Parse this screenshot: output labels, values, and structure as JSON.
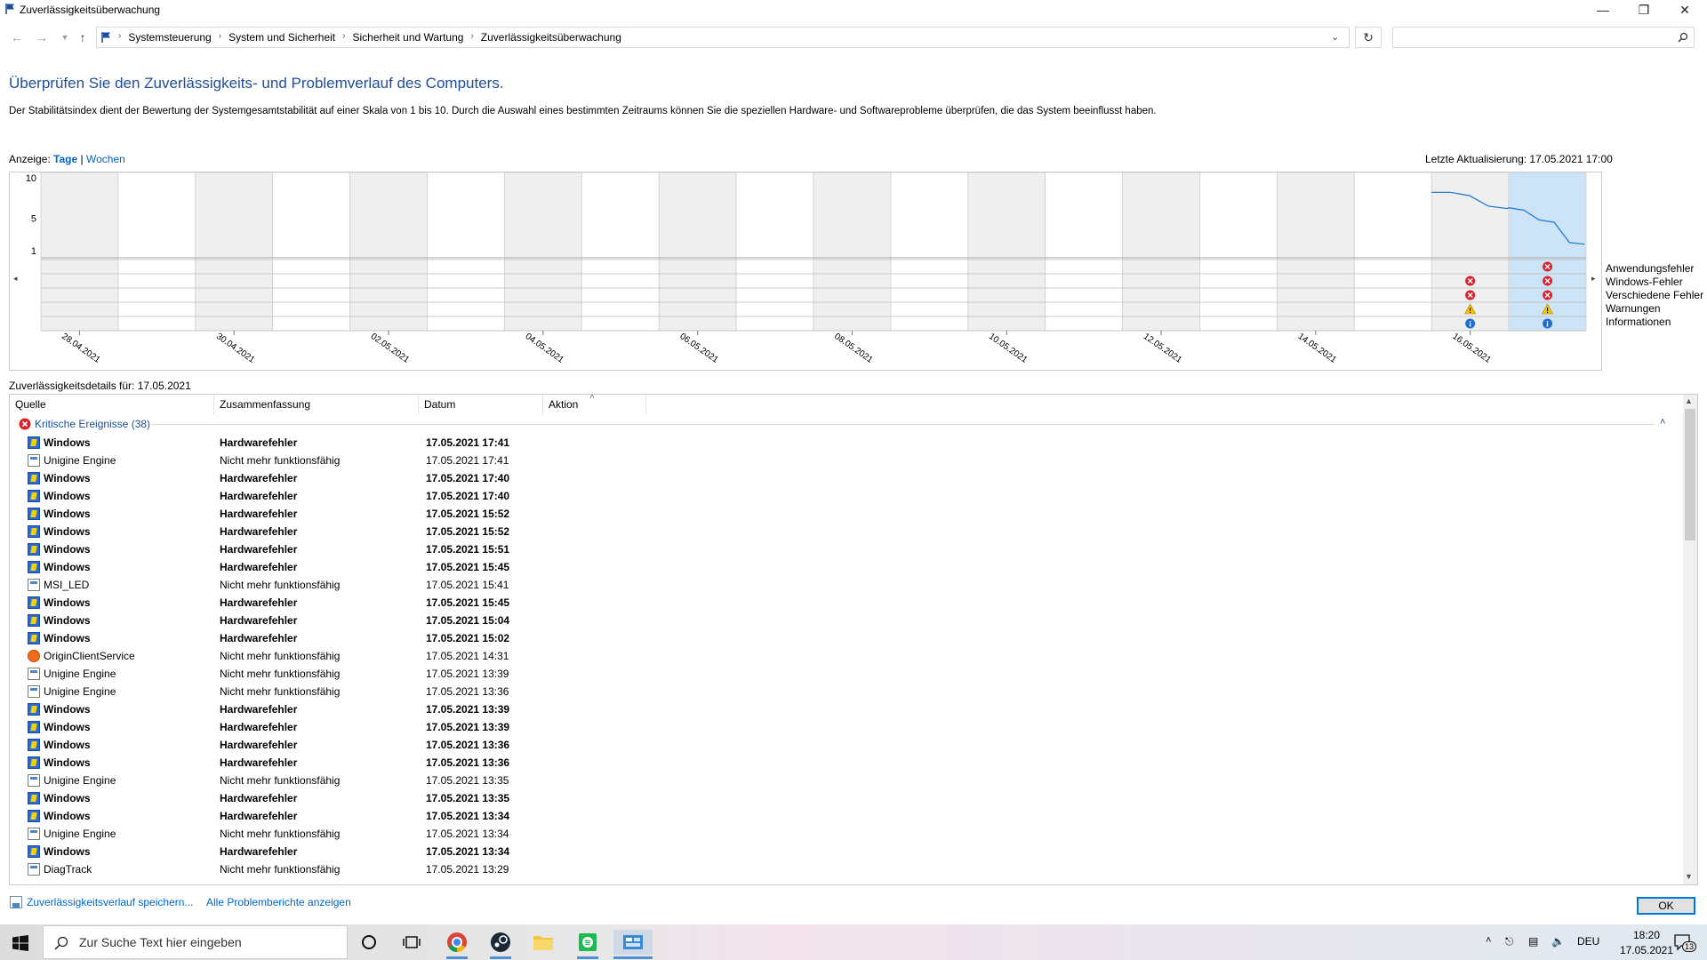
{
  "window": {
    "title": "Zuverlässigkeitsüberwachung"
  },
  "breadcrumb": [
    "Systemsteuerung",
    "System und Sicherheit",
    "Sicherheit und Wartung",
    "Zuverlässigkeitsüberwachung"
  ],
  "heading": "Überprüfen Sie den Zuverlässigkeits- und Problemverlauf des Computers.",
  "description": "Der Stabilitätsindex dient der Bewertung der Systemgesamtstabilität auf einer Skala von 1 bis 10. Durch die Auswahl eines bestimmten Zeitraums können Sie die speziellen Hardware- und Softwareprobleme überprüfen, die das System beeinflusst haben.",
  "view": {
    "label": "Anzeige:",
    "days": "Tage",
    "sep": "|",
    "weeks": "Wochen"
  },
  "last_update": "Letzte Aktualisierung: 17.05.2021 17:00",
  "chart_data": {
    "type": "line",
    "y_ticks": [
      "10",
      "5",
      "1"
    ],
    "ylim": [
      1,
      10
    ],
    "date_labels": [
      "28.04.2021",
      "30.04.2021",
      "02.05.2021",
      "04.05.2021",
      "06.05.2021",
      "08.05.2021",
      "10.05.2021",
      "12.05.2021",
      "14.05.2021",
      "16.05.2021"
    ],
    "stability_points": [
      {
        "day": "16.05.2021",
        "values": [
          8.2,
          8.2,
          7.8,
          6.5,
          6.2
        ]
      },
      {
        "day": "17.05.2021",
        "values": [
          6.3,
          6.0,
          4.8,
          4.5,
          2.0,
          1.8
        ]
      }
    ],
    "event_rows": [
      "Anwendungsfehler",
      "Windows-Fehler",
      "Verschiedene Fehler",
      "Warnungen",
      "Informationen"
    ],
    "events": {
      "16.05.2021": [
        "",
        "error",
        "error",
        "warning",
        "info"
      ],
      "17.05.2021": [
        "error",
        "error",
        "error",
        "warning",
        "info"
      ]
    },
    "selected_day": "17.05.2021"
  },
  "details_label": "Zuverlässigkeitsdetails für: 17.05.2021",
  "table": {
    "columns": [
      "Quelle",
      "Zusammenfassung",
      "Datum",
      "Aktion"
    ],
    "group": "Kritische Ereignisse (38)",
    "rows": [
      {
        "icon": "windows-icon",
        "source": "Windows",
        "summary": "Hardwarefehler",
        "date": "17.05.2021 17:41",
        "bold": true
      },
      {
        "icon": "app-icon",
        "source": "Unigine Engine",
        "summary": "Nicht mehr funktionsfähig",
        "date": "17.05.2021 17:41",
        "bold": false
      },
      {
        "icon": "windows-icon",
        "source": "Windows",
        "summary": "Hardwarefehler",
        "date": "17.05.2021 17:40",
        "bold": true
      },
      {
        "icon": "windows-icon",
        "source": "Windows",
        "summary": "Hardwarefehler",
        "date": "17.05.2021 17:40",
        "bold": true
      },
      {
        "icon": "windows-icon",
        "source": "Windows",
        "summary": "Hardwarefehler",
        "date": "17.05.2021 15:52",
        "bold": true
      },
      {
        "icon": "windows-icon",
        "source": "Windows",
        "summary": "Hardwarefehler",
        "date": "17.05.2021 15:52",
        "bold": true
      },
      {
        "icon": "windows-icon",
        "source": "Windows",
        "summary": "Hardwarefehler",
        "date": "17.05.2021 15:51",
        "bold": true
      },
      {
        "icon": "windows-icon",
        "source": "Windows",
        "summary": "Hardwarefehler",
        "date": "17.05.2021 15:45",
        "bold": true
      },
      {
        "icon": "app-icon",
        "source": "MSI_LED",
        "summary": "Nicht mehr funktionsfähig",
        "date": "17.05.2021 15:41",
        "bold": false
      },
      {
        "icon": "windows-icon",
        "source": "Windows",
        "summary": "Hardwarefehler",
        "date": "17.05.2021 15:45",
        "bold": true
      },
      {
        "icon": "windows-icon",
        "source": "Windows",
        "summary": "Hardwarefehler",
        "date": "17.05.2021 15:04",
        "bold": true
      },
      {
        "icon": "windows-icon",
        "source": "Windows",
        "summary": "Hardwarefehler",
        "date": "17.05.2021 15:02",
        "bold": true
      },
      {
        "icon": "origin-icon",
        "source": "OriginClientService",
        "summary": "Nicht mehr funktionsfähig",
        "date": "17.05.2021 14:31",
        "bold": false
      },
      {
        "icon": "app-icon",
        "source": "Unigine Engine",
        "summary": "Nicht mehr funktionsfähig",
        "date": "17.05.2021 13:39",
        "bold": false
      },
      {
        "icon": "app-icon",
        "source": "Unigine Engine",
        "summary": "Nicht mehr funktionsfähig",
        "date": "17.05.2021 13:36",
        "bold": false
      },
      {
        "icon": "windows-icon",
        "source": "Windows",
        "summary": "Hardwarefehler",
        "date": "17.05.2021 13:39",
        "bold": true
      },
      {
        "icon": "windows-icon",
        "source": "Windows",
        "summary": "Hardwarefehler",
        "date": "17.05.2021 13:39",
        "bold": true
      },
      {
        "icon": "windows-icon",
        "source": "Windows",
        "summary": "Hardwarefehler",
        "date": "17.05.2021 13:36",
        "bold": true
      },
      {
        "icon": "windows-icon",
        "source": "Windows",
        "summary": "Hardwarefehler",
        "date": "17.05.2021 13:36",
        "bold": true
      },
      {
        "icon": "app-icon",
        "source": "Unigine Engine",
        "summary": "Nicht mehr funktionsfähig",
        "date": "17.05.2021 13:35",
        "bold": false
      },
      {
        "icon": "windows-icon",
        "source": "Windows",
        "summary": "Hardwarefehler",
        "date": "17.05.2021 13:35",
        "bold": true
      },
      {
        "icon": "windows-icon",
        "source": "Windows",
        "summary": "Hardwarefehler",
        "date": "17.05.2021 13:34",
        "bold": true
      },
      {
        "icon": "app-icon",
        "source": "Unigine Engine",
        "summary": "Nicht mehr funktionsfähig",
        "date": "17.05.2021 13:34",
        "bold": false
      },
      {
        "icon": "windows-icon",
        "source": "Windows",
        "summary": "Hardwarefehler",
        "date": "17.05.2021 13:34",
        "bold": true
      },
      {
        "icon": "app-icon",
        "source": "DiagTrack",
        "summary": "Nicht mehr funktionsfähig",
        "date": "17.05.2021 13:29",
        "bold": false
      }
    ]
  },
  "footer": {
    "save_link": "Zuverlässigkeitsverlauf speichern...",
    "reports_link": "Alle Problemberichte anzeigen",
    "ok": "OK"
  },
  "taskbar": {
    "search_placeholder": "Zur Suche Text hier eingeben",
    "lang": "DEU",
    "time": "18:20",
    "date": "17.05.2021",
    "notifications": "13"
  },
  "colors": {
    "accent": "#0066cc",
    "heading": "#1e4e9b",
    "selected_col": "#cde4f7",
    "line": "#1c7bd6"
  }
}
